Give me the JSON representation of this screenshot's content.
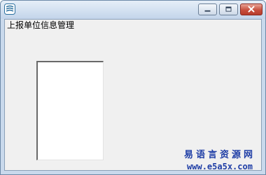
{
  "window": {
    "form_label": "上报单位信息管理"
  },
  "controls": {
    "minimize_icon": "minimize-icon",
    "maximize_icon": "maximize-icon",
    "close_icon": "close-icon"
  },
  "watermark": {
    "title": "易语言资源网",
    "url": "www.e5a5x.com"
  },
  "colors": {
    "close_button": "#c8503f",
    "watermark": "#1f3ea6",
    "client_background": "#f0f0f0"
  }
}
